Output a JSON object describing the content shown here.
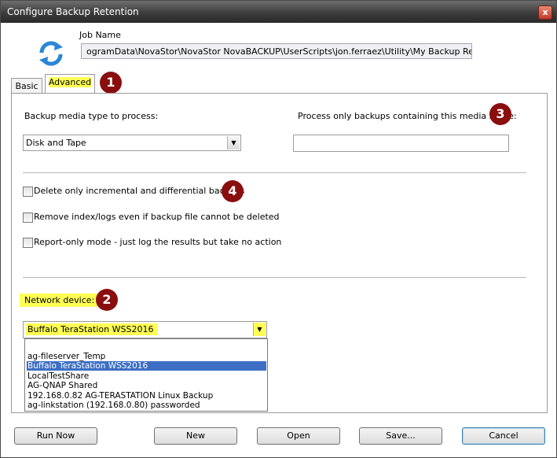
{
  "window": {
    "title": "Configure Backup Retention",
    "close_symbol": "x"
  },
  "job": {
    "label": "Job Name",
    "path": "ogramData\\NovaStor\\NovaStor NovaBACKUP\\UserScripts\\jon.ferraez\\Utility\\My Backup Retention.nbk",
    "icon": "refresh-arrows-icon"
  },
  "tabs": [
    {
      "label": "Basic",
      "selected": false
    },
    {
      "label": "Advanced",
      "selected": true
    }
  ],
  "callouts": [
    "1",
    "2",
    "3",
    "4"
  ],
  "advanced": {
    "media_type_label": "Backup media type to process:",
    "media_type_value": "Disk and Tape",
    "media_name_label": "Process only backups containing this media name:",
    "media_name_value": "",
    "options": [
      {
        "label": "Delete only incremental and differential backups",
        "checked": false
      },
      {
        "label": "Remove index/logs even if backup file cannot be deleted",
        "checked": false
      },
      {
        "label": "Report-only mode - just log the results but take no action",
        "checked": false
      }
    ],
    "network_label": "Network device:",
    "network_value": "Buffalo TeraStation WSS2016",
    "network_options": [
      "ag-fileserver_Temp",
      "Buffalo TeraStation WSS2016",
      "LocalTestShare",
      "AG-QNAP Shared",
      "192.168.0.82 AG-TERASTATION Linux Backup",
      "ag-linkstation (192.168.0.80) passworded"
    ],
    "network_selected_index": 1
  },
  "buttons": {
    "run_now": "Run Now",
    "new": "New",
    "open": "Open",
    "save": "Save...",
    "cancel": "Cancel"
  },
  "colors": {
    "highlight": "#ffff55",
    "callout": "#8a0e0e",
    "selection": "#3d6fc4"
  }
}
